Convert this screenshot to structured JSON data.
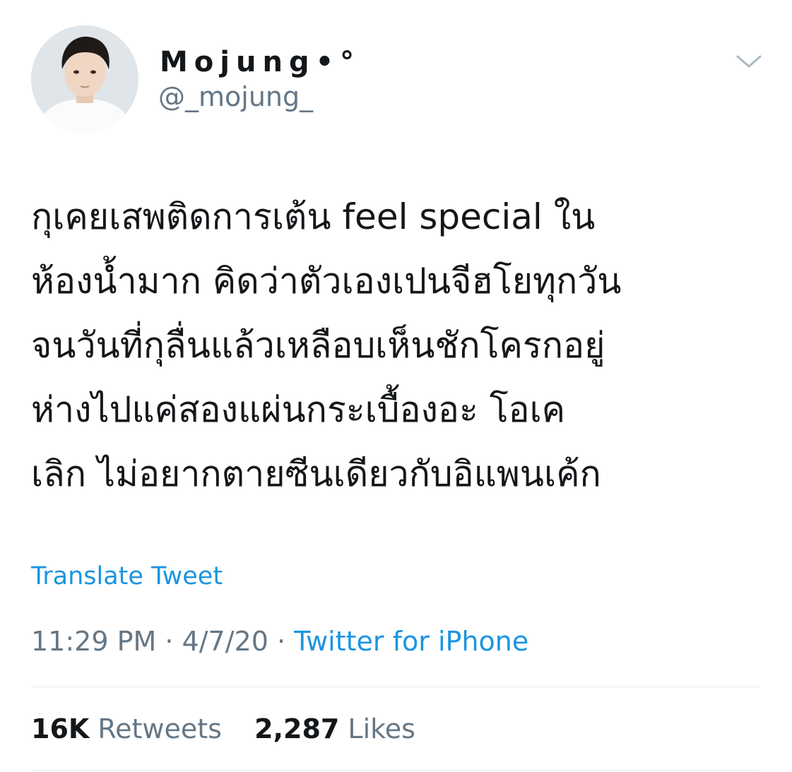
{
  "user": {
    "display_name": "Mojung•°",
    "username": "@_mojung_"
  },
  "tweet": {
    "text_lines": [
      "กุเคยเสพติดการเต้น feel special  ใน",
      "ห้องน้ำมาก คิดว่าตัวเองเปนจีฮโยทุกวัน",
      "จนวันที่กุลื่นแล้วเหลือบเห็นชักโครกอยู่",
      "ห่างไปแค่สองแผ่นกระเบื้องอะ โอเค",
      "เลิก ไม่อยากตายซีนเดียวกับอิแพนเค้ก"
    ],
    "translate_label": "Translate Tweet"
  },
  "meta": {
    "time": "11:29 PM",
    "separator": "·",
    "date": "4/7/20",
    "source": "Twitter for iPhone"
  },
  "stats": {
    "retweets_count": "16K",
    "retweets_label": "Retweets",
    "likes_count": "2,287",
    "likes_label": "Likes"
  },
  "icons": {
    "menu": "chevron-down-icon"
  },
  "colors": {
    "link": "#1b95e0",
    "secondary_text": "#657786",
    "primary_text": "#14171a",
    "divider": "#e1e8ed"
  }
}
